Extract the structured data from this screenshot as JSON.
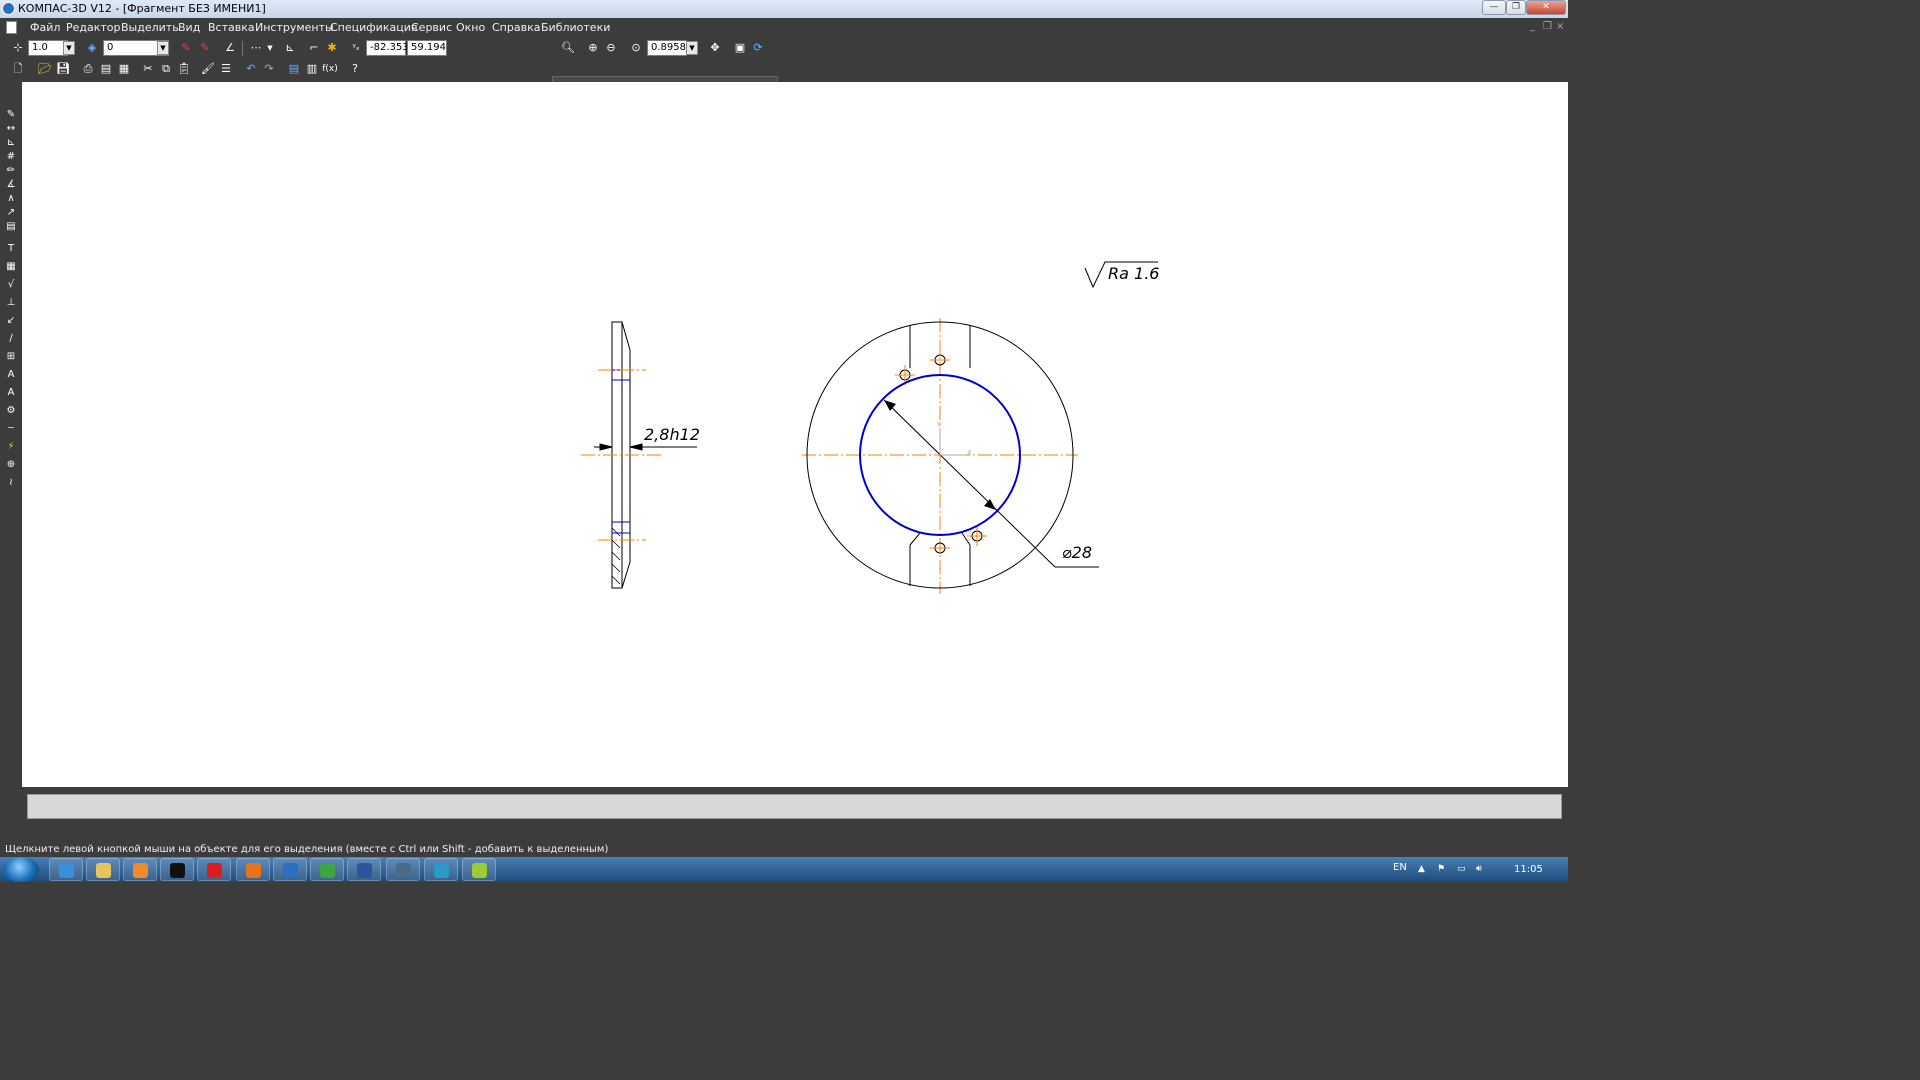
{
  "window": {
    "title": "КОМПАС-3D V12 - [Фрагмент БЕЗ ИМЕНИ1]",
    "minimize_label": "—",
    "maximize_label": "❐",
    "close_label": "✕"
  },
  "menu": {
    "items": [
      {
        "label": "Файл"
      },
      {
        "label": "Редактор"
      },
      {
        "label": "Выделить"
      },
      {
        "label": "Вид"
      },
      {
        "label": "Вставка"
      },
      {
        "label": "Инструменты"
      },
      {
        "label": "Спецификация"
      },
      {
        "label": "Сервис"
      },
      {
        "label": "Окно"
      },
      {
        "label": "Справка"
      },
      {
        "label": "Библиотеки"
      }
    ],
    "mdi_min": "_",
    "mdi_restore": "❐",
    "mdi_close": "×"
  },
  "toolbar": {
    "step_value": "1.0",
    "layer_value": "0",
    "coord_x": "-82.353",
    "coord_y": "59.194",
    "zoom_value": "0.8958",
    "fx_label": "f(x)",
    "help_label": "?"
  },
  "drawing": {
    "roughness": "Ra 1.6",
    "thickness_dim": "2,8h12",
    "diameter_dim": "⌀28",
    "axis_y": "Y",
    "axis_x": "X",
    "colors": {
      "outline": "#000000",
      "axis": "#ff7f00",
      "selected": "#0000cc"
    }
  },
  "status": {
    "hint": "Щелкните левой кнопкой мыши на объекте для его выделения (вместе с Ctrl или Shift - добавить к выделенным)"
  },
  "taskbar": {
    "lang": "EN",
    "clock": "11:05",
    "apps": [
      {
        "icon": "internet-explorer-icon",
        "color": "#3a8fd8"
      },
      {
        "icon": "explorer-folder-icon",
        "color": "#e8c45a"
      },
      {
        "icon": "media-player-icon",
        "color": "#f08a2a"
      },
      {
        "icon": "app-black-icon",
        "color": "#111111"
      },
      {
        "icon": "yandex-browser-icon",
        "color": "#d81e1e"
      },
      {
        "icon": "firefox-icon",
        "color": "#e8731a"
      },
      {
        "icon": "kompas-icon",
        "color": "#2a6fc0"
      },
      {
        "icon": "green-app-icon",
        "color": "#3fa53f"
      },
      {
        "icon": "word-icon",
        "color": "#2b579a"
      },
      {
        "icon": "screen-app-icon",
        "color": "#4a6a8a"
      },
      {
        "icon": "chrome-like-icon",
        "color": "#2c9ac8"
      },
      {
        "icon": "multicolor-app-icon",
        "color": "#9bcc32"
      }
    ]
  }
}
